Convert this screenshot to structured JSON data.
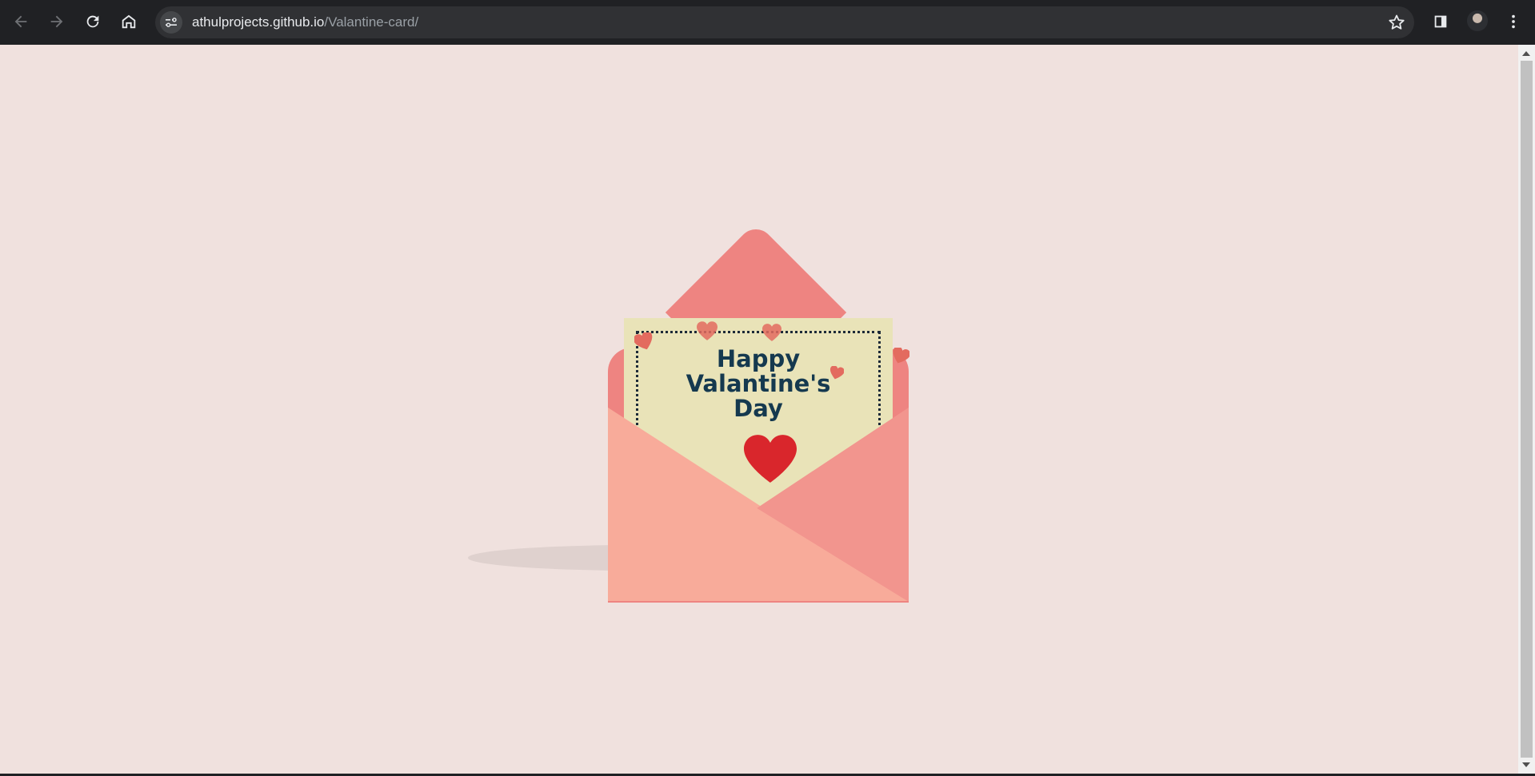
{
  "browser": {
    "url_host": "athulprojects.github.io",
    "url_path": "/Valantine-card/",
    "icons": [
      "back-arrow-icon",
      "forward-arrow-icon",
      "reload-icon",
      "home-icon",
      "site-info-icon",
      "bookmark-star-icon",
      "side-panel-icon",
      "profile-avatar",
      "kebab-menu-icon"
    ]
  },
  "card": {
    "line1": "Happy",
    "line2": "Valantine's",
    "line3": "Day"
  },
  "colors": {
    "page_background": "#f0e1de",
    "envelope_back": "#ee8481",
    "envelope_front": "#f8ab9a",
    "envelope_side": "#f2958e",
    "letter": "#e9e3b8",
    "text": "#15394f",
    "heart_main": "#d9262c",
    "heart_small": "#e36b5f"
  }
}
